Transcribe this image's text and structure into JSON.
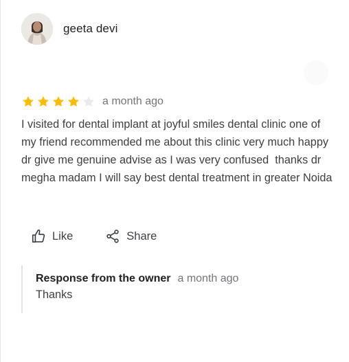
{
  "review": {
    "reviewer_name": "geeta devi",
    "rating": 4,
    "rating_max": 5,
    "date": "a month ago",
    "text": "I visited for dental implant at joyful smiles dental clinic one of my friend recommended me about this clinic very much happy dr give me genuine advise as I was very confused  thanks dr megha madam I will say best dental treatment in greater Noida",
    "star_color": "#fbbc04",
    "star_empty_color": "#e8eaed"
  },
  "actions": {
    "like_label": "Like",
    "like_icon": "thumbs-up-outline-icon",
    "share_label": "Share",
    "share_icon": "share-icon"
  },
  "owner_response": {
    "title": "Response from the owner",
    "date": "a month ago",
    "text": "Thanks"
  }
}
